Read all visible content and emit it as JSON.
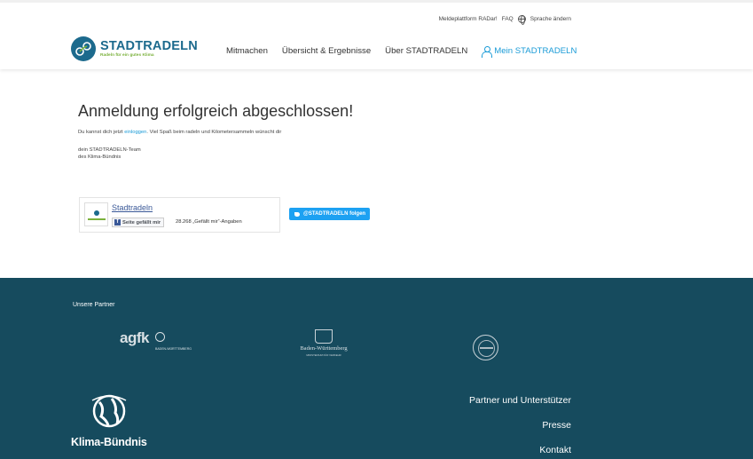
{
  "topbar": {
    "meldeplattform": "Meldeplattform RADar!",
    "faq": "FAQ",
    "language": "Sprache ändern",
    "language_icon": "globe-icon"
  },
  "logo": {
    "title": "STADTRADELN",
    "subtitle": "Radeln für ein gutes Klima"
  },
  "nav": {
    "items": [
      "Mitmachen",
      "Übersicht & Ergebnisse",
      "Über STADTRADELN"
    ],
    "my_account": "Mein STADTRADELN",
    "my_account_icon": "user-icon"
  },
  "main": {
    "heading": "Anmeldung erfolgreich abgeschlossen!",
    "line1_before": "Du kannst dich jetzt ",
    "line1_link": "einloggen",
    "line1_after": ". Viel Spaß beim radeln und Kilometersammeln wünscht dir",
    "signature_line1": "dein STADTRADELN-Team",
    "signature_line2": "des Klima-Bündnis"
  },
  "facebook": {
    "page_name": "Stadtradeln",
    "like_button": "Seite gefällt mir",
    "like_count": "28.268 „Gefällt mir“-Angaben"
  },
  "twitter": {
    "follow_button": "@STADTRADELN folgen"
  },
  "footer": {
    "partners_title": "Unsere Partner",
    "agfk_word": "agfk",
    "agfk_sub": "BADEN-WÜRTTEMBERG",
    "bw_name": "Baden-Württemberg",
    "bw_sub": "MINISTERIUM FÜR VERKEHR",
    "klima_name": "Klima-Bündnis",
    "links": [
      "Partner und Unterstützer",
      "Presse",
      "Kontakt"
    ]
  },
  "colors": {
    "brand_blue": "#1c6a8d",
    "link_blue": "#1a9bd7",
    "brand_green": "#7bb13c",
    "footer_bg": "#164b5e",
    "twitter_blue": "#1da1f2"
  }
}
